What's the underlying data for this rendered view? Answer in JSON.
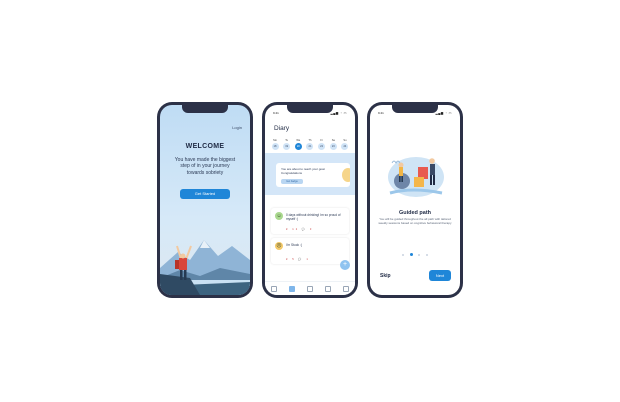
{
  "colors": {
    "frame": "#2c3147",
    "accent": "#1f86d8",
    "light_blue": "#d4e6f8",
    "sky": "#bfdcf4"
  },
  "onboarding": {
    "login_label": "Login",
    "title": "WELCOME",
    "message": "You have made the biggest step of in your journey towards sobriety",
    "cta_label": "Get Started"
  },
  "diary": {
    "status_time": "9:41",
    "status_icons": "▂▄▆ ◔ ▭",
    "title": "Diary",
    "days": [
      {
        "name": "Mo",
        "num": "18"
      },
      {
        "name": "Tu",
        "num": "19"
      },
      {
        "name": "We",
        "num": "20"
      },
      {
        "name": "Th",
        "num": "21"
      },
      {
        "name": "Fr",
        "num": "22"
      },
      {
        "name": "Sa",
        "num": "23"
      },
      {
        "name": "Su",
        "num": "24"
      }
    ],
    "goal_text": "You are about to reach your goal. Congratulations",
    "goal_button": "Get badge",
    "entries": [
      {
        "mood_icon": "smile-icon",
        "emoji": "☺",
        "text": "0 days without drinking! Im so proud of myself :)",
        "meta": "♥ 12  💬 3"
      },
      {
        "mood_icon": "neutral-face-icon",
        "emoji": "☹",
        "text": "I'm Stuck :(",
        "meta": "♥ 5  💬 1"
      }
    ],
    "fab_label": "+"
  },
  "guide": {
    "status_time": "9:41",
    "status_icons": "▂▄▆ ◔ ▭",
    "title": "Guided path",
    "text": "You will be guided throughout the all path with tailored weekly sessions based on cognitive behavioral therapy",
    "skip_label": "Skip",
    "next_label": "Next"
  }
}
